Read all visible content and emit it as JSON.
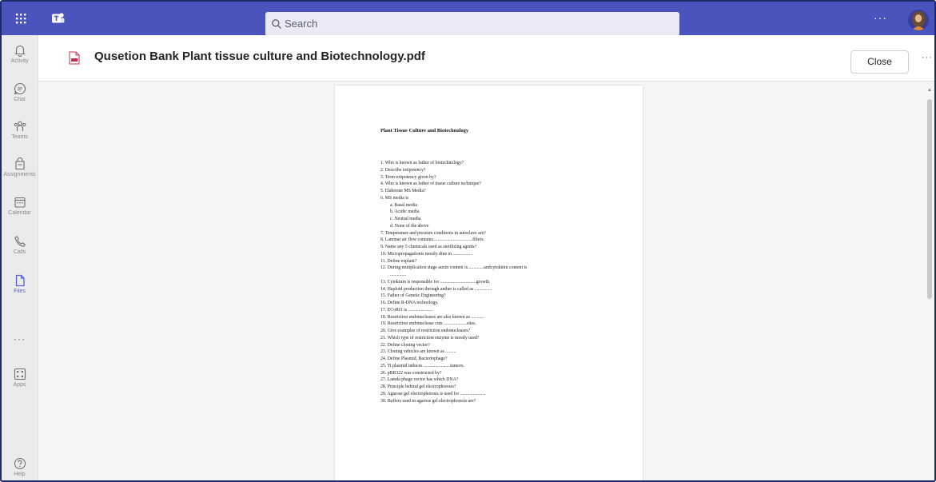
{
  "topbar": {
    "search_placeholder": "Search",
    "more_label": "···"
  },
  "rail": {
    "items": [
      {
        "label": "Activity",
        "icon": "bell-icon"
      },
      {
        "label": "Chat",
        "icon": "chat-icon"
      },
      {
        "label": "Teams",
        "icon": "teams-icon"
      },
      {
        "label": "Assignments",
        "icon": "assignments-icon"
      },
      {
        "label": "Calendar",
        "icon": "calendar-icon"
      },
      {
        "label": "Calls",
        "icon": "phone-icon"
      },
      {
        "label": "Files",
        "icon": "file-icon"
      }
    ],
    "more_label": "···",
    "apps_label": "Apps",
    "help_label": "Help"
  },
  "header": {
    "file_title": "Qusetion Bank Plant tissue culture and Biotechnology.pdf",
    "close_label": "Close",
    "more_label": "···"
  },
  "document": {
    "title": "Plant Tissue Culture and Biotechnology",
    "lines": [
      "1. Who is known as father of biotechnology?",
      "2. Describe totipotency?",
      "3. Term totipotency given by?",
      "4. Who is known as father of tissue culture technique?",
      "5. Elaborate MS Media?",
      "6. MS media is",
      "a.   Basal media",
      "b.   Acidic media",
      "c.   Neutral media",
      "d.   None of the above",
      "7. Temperature and pressure conditions in autoclave are?",
      "8. Laminar air flow contains..................................filters.",
      "9. Name any 5 chemicals used as sterilizing agents?",
      "10. Micropropagationis mostly dine in .................",
      "11. Define explant?",
      "12. During mutiplication stage auxin content is..............andcytokinin content is",
      "..............",
      "13. Cytokinin is responsible for ...............................growth.",
      "14. Haploid production through anther is called as ...............",
      "15. Father of Genetic Engineering?",
      "16. Define R-DNA technology.",
      "17. ECoRI1 is .....................",
      "18. Restriction endonucleases are also known as ...........",
      "19. Restriction endonuclease cuts ....................sites.",
      "20. Give examples of restriction endonucleases?",
      "21. Which type of restriction enzyme is mostly used?",
      "22. Define cloning vector?",
      "23. Cloning vehicles are known as .........",
      "24. Define Plasmid, Bacteriophage?",
      "25. Ti plasmid induces .......................tumors.",
      "26. pBR322 was constructed by?",
      "27. Lamda phage vector has which DNA?",
      "28. Principle behind gel electrophoresis?",
      "29. Agarose gel electrophoresis is used for ......................",
      "30. Buffers used in agarose gel electrophoresis are?"
    ]
  },
  "colors": {
    "topbar": "#4b53bc",
    "rail_active": "#5b5fc7",
    "pdf_red": "#c4314b"
  }
}
